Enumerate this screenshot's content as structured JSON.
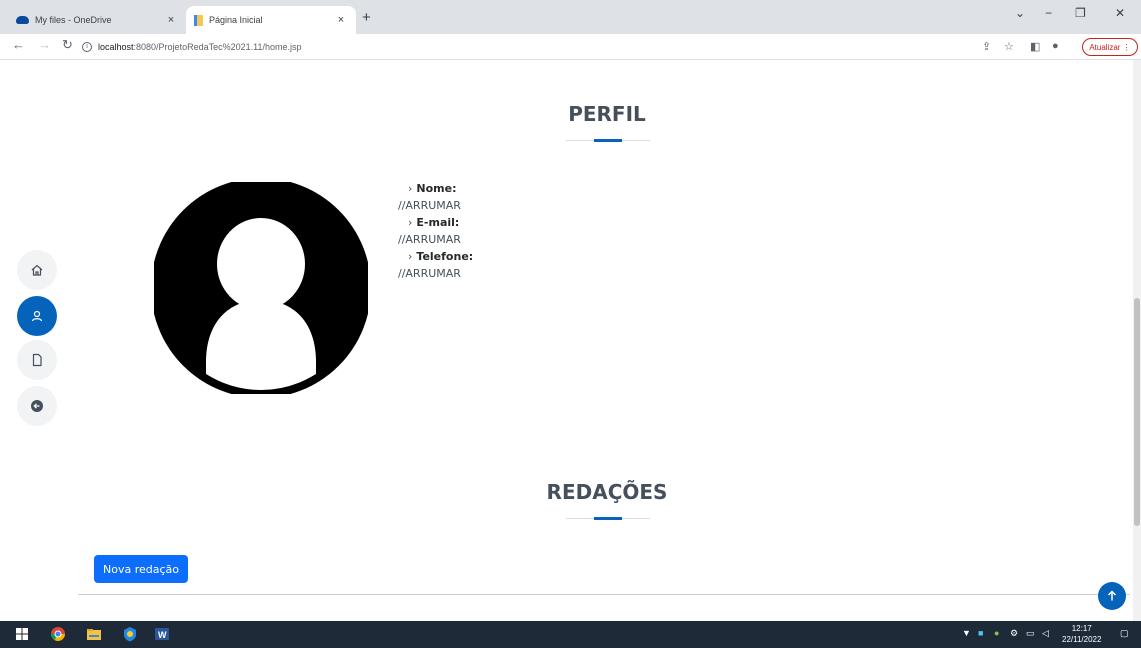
{
  "browser": {
    "tabs": [
      {
        "title": "My files - OneDrive",
        "close": "×"
      },
      {
        "title": "Página Inicial",
        "close": "×"
      }
    ],
    "new_tab": "+",
    "url_host": "localhost",
    "url_path": ":8080/ProjetoRedaTec%2021.11/home.jsp",
    "update_label": "Atualizar",
    "window_controls": {
      "minimize": "−",
      "maximize": "❐",
      "close": "✕",
      "tab_search": "⌄"
    }
  },
  "profile": {
    "title": "PERFIL",
    "fields": [
      {
        "label": "Nome:",
        "value": "//ARRUMAR"
      },
      {
        "label": "E-mail:",
        "value": "//ARRUMAR"
      },
      {
        "label": "Telefone:",
        "value": "//ARRUMAR"
      }
    ]
  },
  "essays": {
    "title": "REDAÇÕES",
    "new_button": "Nova redação"
  },
  "sidenav": {
    "items": [
      "home-icon",
      "person-icon",
      "file-icon",
      "arrow-left-circle-icon"
    ],
    "active_index": 1
  },
  "taskbar": {
    "time": "12:17",
    "date": "22/11/2022"
  },
  "colors": {
    "accent": "#0563bb",
    "button": "#0d6efd",
    "heading": "#45505b"
  }
}
